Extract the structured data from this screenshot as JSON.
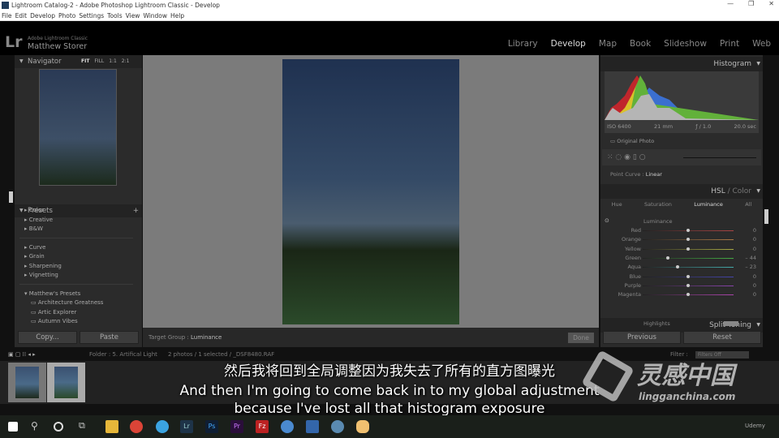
{
  "window": {
    "title": "Lightroom Catalog-2 - Adobe Photoshop Lightroom Classic - Develop",
    "controls": [
      "—",
      "❐",
      "✕"
    ]
  },
  "menu": [
    "File",
    "Edit",
    "Develop",
    "Photo",
    "Settings",
    "Tools",
    "View",
    "Window",
    "Help"
  ],
  "identity": {
    "logo": "Lr",
    "product": "Adobe Lightroom Classic",
    "user": "Matthew Storer"
  },
  "modules": [
    {
      "label": "Library"
    },
    {
      "label": "Develop",
      "active": true
    },
    {
      "label": "Map"
    },
    {
      "label": "Book"
    },
    {
      "label": "Slideshow"
    },
    {
      "label": "Print"
    },
    {
      "label": "Web"
    }
  ],
  "navigator": {
    "title": "Navigator",
    "zoom": [
      "FIT",
      "FILL",
      "1:1",
      "2:1"
    ]
  },
  "presets": {
    "title": "Presets",
    "groups": [
      [
        "Color",
        "Creative",
        "B&W"
      ],
      [
        "Curve",
        "Grain",
        "Sharpening",
        "Vignetting"
      ]
    ],
    "user_group": "Matthew's Presets",
    "user_items": [
      "Architecture Greatness",
      "Artic Explorer",
      "Autumn Vibes"
    ]
  },
  "left_buttons": {
    "copy": "Copy...",
    "paste": "Paste"
  },
  "toolbar": {
    "target_label": "Target Group :",
    "target_value": "Luminance",
    "done": "Done"
  },
  "histogram": {
    "title": "Histogram",
    "iso": "ISO 6400",
    "focal": "21 mm",
    "aperture": "ƒ / 1.0",
    "shutter": "20.0 sec",
    "original": "Original Photo"
  },
  "point_curve": {
    "label": "Point Curve :",
    "value": "Linear"
  },
  "hsl": {
    "title": "HSL",
    "title2": "/ Color",
    "tabs": [
      "Hue",
      "Saturation",
      "Luminance",
      "All"
    ],
    "active_tab": "Luminance",
    "section": "Luminance",
    "sliders": [
      {
        "name": "Red",
        "value": "0",
        "pos": 0
      },
      {
        "name": "Orange",
        "value": "0",
        "pos": 0
      },
      {
        "name": "Yellow",
        "value": "0",
        "pos": 0
      },
      {
        "name": "Green",
        "value": "– 44",
        "pos": -44
      },
      {
        "name": "Aqua",
        "value": "– 23",
        "pos": -23
      },
      {
        "name": "Blue",
        "value": "0",
        "pos": 0
      },
      {
        "name": "Purple",
        "value": "0",
        "pos": 0
      },
      {
        "name": "Magenta",
        "value": "0",
        "pos": 0
      }
    ]
  },
  "split_toning": {
    "title": "Split Toning",
    "highlights": "Highlights"
  },
  "right_buttons": {
    "previous": "Previous",
    "reset": "Reset"
  },
  "filmstrip": {
    "folder": "Folder : 5. Artifical Light",
    "count": "2 photos / 1 selected / _DSF8480.RAF",
    "filter_label": "Filter :",
    "filter_value": "Filters Off",
    "thumb_numbers": [
      "1",
      "2"
    ]
  },
  "subtitles": {
    "zh": "然后我将回到全局调整因为我失去了所有的直方图曝光",
    "en1": "And then I'm going to come back in to my global adjustment",
    "en2": "because I've lost all that histogram exposure"
  },
  "watermark": {
    "zh": "灵感中国",
    "url": "lingganchina.com",
    "brand": "Udemy"
  },
  "taskbar": [
    "windows-start",
    "search",
    "cortana",
    "task-view",
    "file-explorer",
    "chrome",
    "info-app",
    "lightroom",
    "photoshop",
    "premiere",
    "filezilla",
    "app-globe",
    "app-photo",
    "app-circle",
    "app-weather"
  ]
}
